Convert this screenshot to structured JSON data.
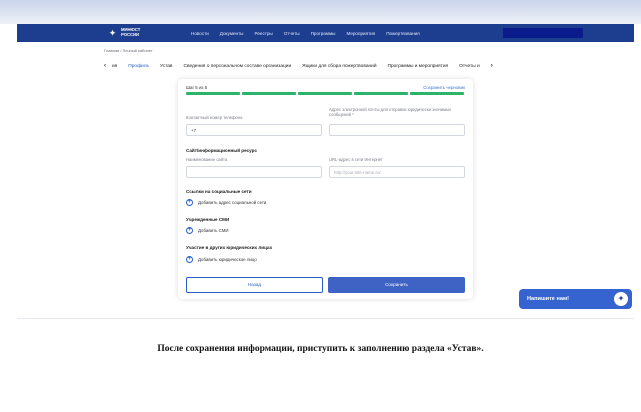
{
  "colors": {
    "navbar": "#1d3d8f",
    "accent": "#2860c7",
    "progress": "#2bb46a",
    "chat": "#3563d0"
  },
  "header": {
    "logo_icon": "eagle-emblem-icon",
    "logo_line1": "МИНЮСТ",
    "logo_line2": "РОССИИ",
    "menu": [
      "Новости",
      "Документы",
      "Реестры",
      "Отчеты",
      "Программы",
      "Мероприятия",
      "Пожертвования"
    ]
  },
  "breadcrumb": {
    "home": "Главная",
    "sep": "/",
    "current": "Личный кабинет"
  },
  "tabs": {
    "prev_icon": "chevron-left-icon",
    "next_icon": "chevron-right-icon",
    "items": [
      "ия",
      "Профиль",
      "Устав",
      "Сведения о персональном составе организации",
      "Ящики для сбора пожертвований",
      "Программы и мероприятия",
      "Отчеты и"
    ],
    "active_index": 1
  },
  "form": {
    "step": "Шаг 5 из 5",
    "save_draft": "Сохранить черновик",
    "progress": {
      "completed_steps": 5,
      "total_steps": 5
    },
    "phone_label": "Контактный номер телефона",
    "phone_value": "+7",
    "email_label": "Адрес электронной почты для отправки юридически значимых сообщений *",
    "email_value": "",
    "site_section": "Сайт/информационный ресурс",
    "site_name_label": "Наименование сайта",
    "site_name_value": "",
    "site_url_label": "URL-адрес в сети Интернет",
    "site_url_placeholder": "http://your-site-name.ru/",
    "social_section": "Ссылки на социальные сети",
    "social_add": "Добавить адрес социальной сети",
    "media_section": "Учрежденные СМИ",
    "media_add": "Добавить СМИ",
    "entity_section": "Участие в других юридических лицах",
    "entity_add": "Добавить юридическое лицо",
    "back_button": "Назад",
    "save_button": "Сохранить"
  },
  "chat": {
    "label": "Напишите нам!",
    "icon": "eagle-emblem-icon"
  },
  "caption": "После сохранения информации, приступить к заполнению раздела «Устав»."
}
